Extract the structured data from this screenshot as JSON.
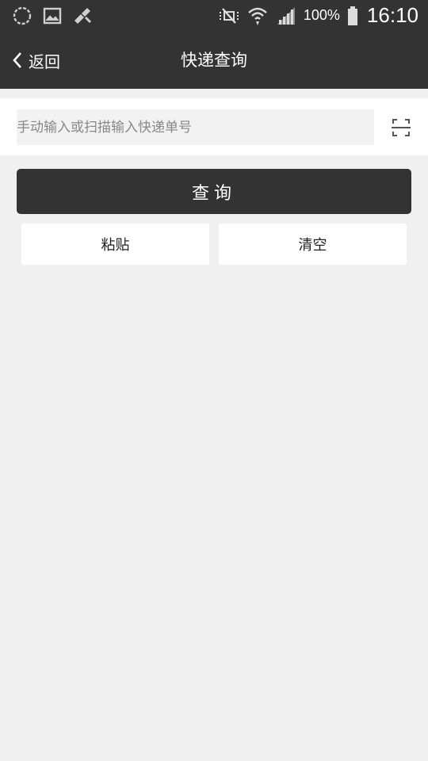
{
  "status_bar": {
    "battery_percent": "100%",
    "time": "16:10",
    "icons": [
      "sync-icon",
      "image-icon",
      "cleaner-icon",
      "mute-icon",
      "wifi-icon",
      "signal-icon",
      "battery-icon"
    ]
  },
  "navbar": {
    "back_label": "返回",
    "title": "快递查询"
  },
  "search": {
    "value": "",
    "placeholder": "手动输入或扫描输入快递单号"
  },
  "actions": {
    "query_label": "查询",
    "paste_label": "粘贴",
    "clear_label": "清空"
  },
  "colors": {
    "bar": "#333333",
    "background": "#f0f0f0",
    "input_bg": "#f2f2f2"
  }
}
